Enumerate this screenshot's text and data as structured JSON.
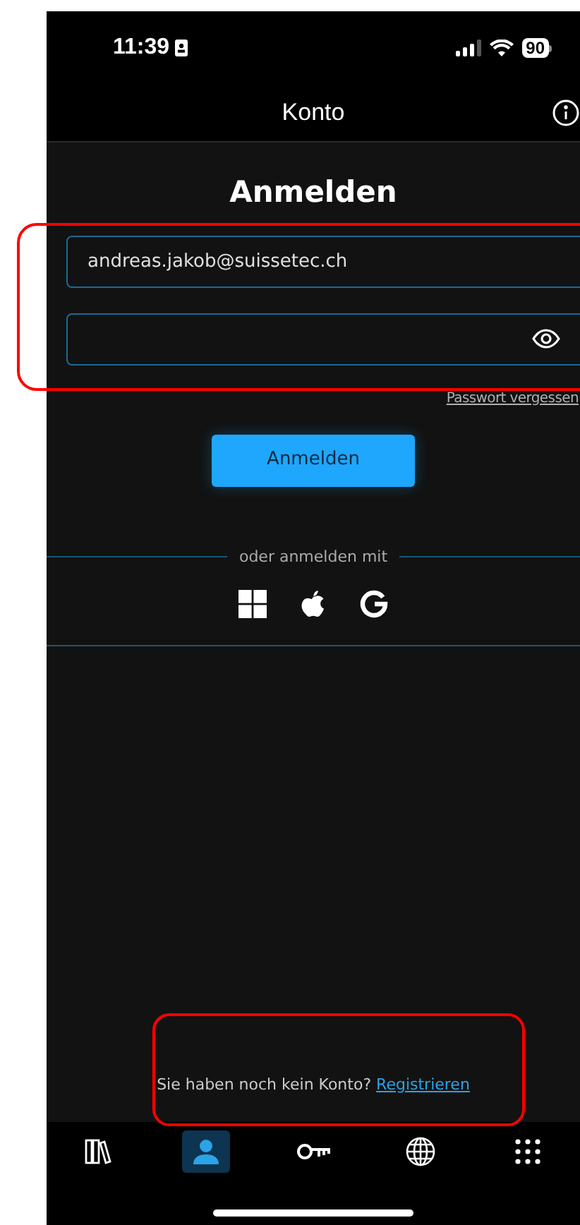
{
  "status_bar": {
    "time": "11:39",
    "battery": "90"
  },
  "header": {
    "title": "Konto"
  },
  "login": {
    "title": "Anmelden",
    "email": {
      "value": "andreas.jakob@suissetec.ch"
    },
    "password": {
      "masked": true
    },
    "forgot_link": "Passwort vergessen",
    "submit": "Anmelden",
    "divider_text": "oder anmelden mit",
    "providers": [
      {
        "kind": "windows"
      },
      {
        "kind": "apple"
      },
      {
        "kind": "google"
      }
    ]
  },
  "register": {
    "text": "Sie haben noch kein Konto?",
    "link": "Registrieren"
  },
  "tab_bar": [
    {
      "kind": "books",
      "selected": false
    },
    {
      "kind": "person",
      "selected": true
    },
    {
      "kind": "key",
      "selected": false
    },
    {
      "kind": "globe",
      "selected": false
    },
    {
      "kind": "apps",
      "selected": false
    }
  ]
}
